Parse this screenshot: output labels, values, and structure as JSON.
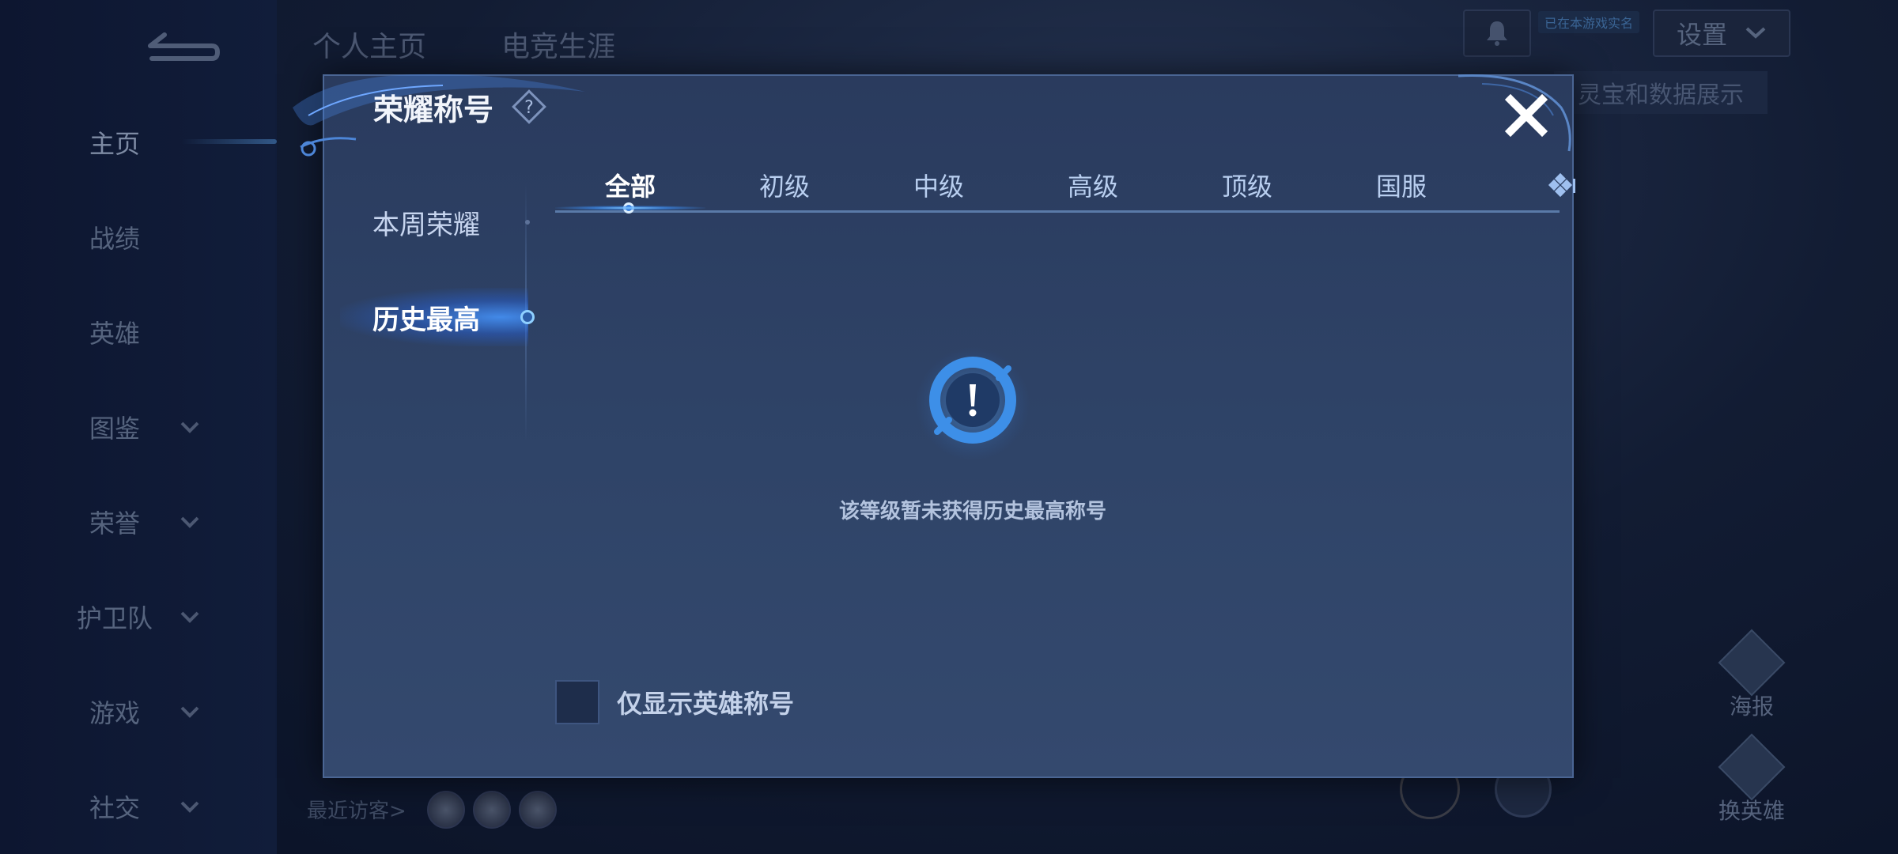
{
  "background": {
    "nav_items": [
      {
        "label": "主页",
        "has_chevron": false,
        "active": true
      },
      {
        "label": "战绩",
        "has_chevron": false
      },
      {
        "label": "英雄",
        "has_chevron": false
      },
      {
        "label": "图鉴",
        "has_chevron": true
      },
      {
        "label": "荣誉",
        "has_chevron": true
      },
      {
        "label": "护卫队",
        "has_chevron": true
      },
      {
        "label": "游戏",
        "has_chevron": true
      },
      {
        "label": "社交",
        "has_chevron": true
      }
    ],
    "top_tabs": [
      "个人主页",
      "电竞生涯"
    ],
    "realname_badge": "已在本游戏实名",
    "settings_label": "设置",
    "lingbao_banner": "灵宝和数据展示",
    "poster_label": "海报",
    "switch_hero_label": "换英雄",
    "recent_visitors_label": "最近访客>"
  },
  "modal": {
    "title": "荣耀称号",
    "side_tabs": [
      {
        "label": "本周荣耀",
        "active": false
      },
      {
        "label": "历史最高",
        "active": true
      }
    ],
    "rank_tabs": [
      {
        "label": "全部",
        "active": true
      },
      {
        "label": "初级",
        "active": false
      },
      {
        "label": "中级",
        "active": false
      },
      {
        "label": "高级",
        "active": false
      },
      {
        "label": "顶级",
        "active": false
      },
      {
        "label": "国服",
        "active": false
      }
    ],
    "empty_message": "该等级暂未获得历史最高称号",
    "filter_label": "仅显示英雄称号",
    "filter_checked": false
  },
  "colors": {
    "modal_bg": "#2f4468",
    "accent_glow": "#4a9bff",
    "active_text": "#ffffff",
    "inactive_text": "#b9cff0"
  }
}
